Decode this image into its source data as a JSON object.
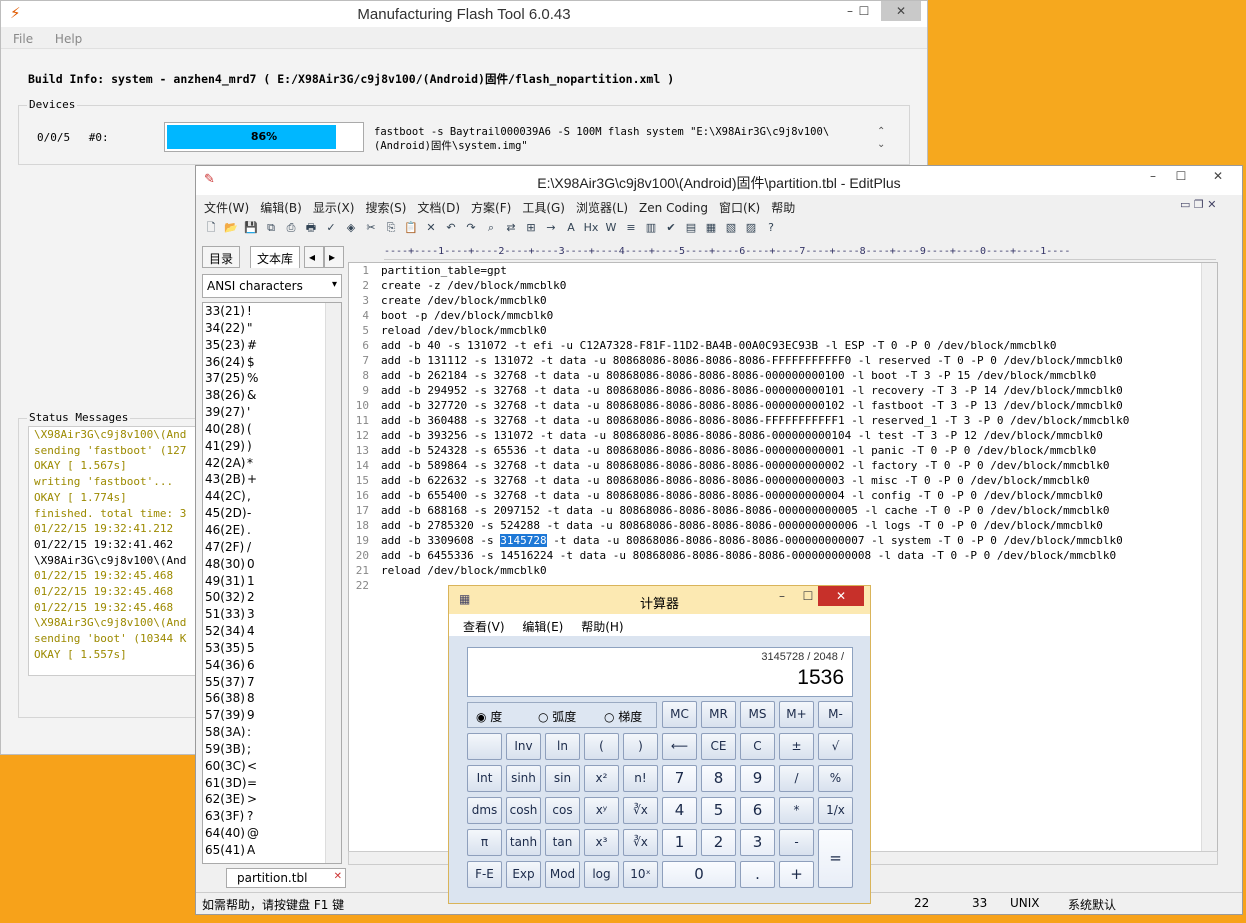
{
  "flash": {
    "title": "Manufacturing Flash Tool 6.0.43",
    "menu": [
      "File",
      "Help"
    ],
    "build_info": "Build Info: system - anzhen4_mrd7 ( E:/X98Air3G/c9j8v100/(Android)固件/flash_nopartition.xml )",
    "devices_title": "Devices",
    "device_port": "0/0/5",
    "device_id": "#0:",
    "progress_text": "86%",
    "progress_value": 86,
    "command": "fastboot -s Baytrail000039A6 -S 100M  flash system \"E:\\X98Air3G\\c9j8v100\\(Android)固件\\system.img\"",
    "status_title": "Status Messages",
    "status_lines": [
      {
        "t": "\\X98Air3G\\c9j8v100\\(And",
        "k": "y"
      },
      {
        "t": "sending 'fastboot' (127",
        "k": "y"
      },
      {
        "t": "OKAY [  1.567s]",
        "k": "y"
      },
      {
        "t": "writing 'fastboot'...",
        "k": "y"
      },
      {
        "t": "OKAY [  1.774s]",
        "k": "y"
      },
      {
        "t": "finished. total time: 3",
        "k": "y"
      },
      {
        "t": "01/22/15 19:32:41.212",
        "k": "y"
      },
      {
        "t": "01/22/15 19:32:41.462",
        "k": "b"
      },
      {
        "t": "\\X98Air3G\\c9j8v100\\(And",
        "k": "b"
      },
      {
        "t": "01/22/15 19:32:45.468",
        "k": "y"
      },
      {
        "t": "01/22/15 19:32:45.468",
        "k": "y"
      },
      {
        "t": "01/22/15 19:32:45.468",
        "k": "y"
      },
      {
        "t": "\\X98Air3G\\c9j8v100\\(And",
        "k": "y"
      },
      {
        "t": "sending 'boot' (10344 K",
        "k": "y"
      },
      {
        "t": "OKAY [  1.557s]",
        "k": "y"
      }
    ]
  },
  "editplus": {
    "title": "E:\\X98Air3G\\c9j8v100\\(Android)固件\\partition.tbl - EditPlus",
    "menu": [
      "文件(W)",
      "编辑(B)",
      "显示(X)",
      "搜索(S)",
      "文档(D)",
      "方案(F)",
      "工具(G)",
      "浏览器(L)",
      "Zen Coding",
      "窗口(K)",
      "帮助"
    ],
    "tab_dir": "目录",
    "tab_lib": "文本库",
    "ansi_label": "ANSI characters",
    "chars": [
      [
        "33(21)",
        "!"
      ],
      [
        "34(22)",
        "\""
      ],
      [
        "35(23)",
        "#"
      ],
      [
        "36(24)",
        "$"
      ],
      [
        "37(25)",
        "%"
      ],
      [
        "38(26)",
        "&"
      ],
      [
        "39(27)",
        "'"
      ],
      [
        "40(28)",
        "("
      ],
      [
        "41(29)",
        ")"
      ],
      [
        "42(2A)",
        "*"
      ],
      [
        "43(2B)",
        "+"
      ],
      [
        "44(2C)",
        ","
      ],
      [
        "45(2D)",
        "-"
      ],
      [
        "46(2E)",
        "."
      ],
      [
        "47(2F)",
        "/"
      ],
      [
        "48(30)",
        "0"
      ],
      [
        "49(31)",
        "1"
      ],
      [
        "50(32)",
        "2"
      ],
      [
        "51(33)",
        "3"
      ],
      [
        "52(34)",
        "4"
      ],
      [
        "53(35)",
        "5"
      ],
      [
        "54(36)",
        "6"
      ],
      [
        "55(37)",
        "7"
      ],
      [
        "56(38)",
        "8"
      ],
      [
        "57(39)",
        "9"
      ],
      [
        "58(3A)",
        ":"
      ],
      [
        "59(3B)",
        ";"
      ],
      [
        "60(3C)",
        "<"
      ],
      [
        "61(3D)",
        "="
      ],
      [
        "62(3E)",
        ">"
      ],
      [
        "63(3F)",
        "?"
      ],
      [
        "64(40)",
        "@"
      ],
      [
        "65(41)",
        "A"
      ]
    ],
    "ruler": "----+----1----+----2----+----3----+----4----+----5----+----6----+----7----+----8----+----9----+----0----+----1----",
    "lines": [
      "partition_table=gpt",
      "create -z /dev/block/mmcblk0",
      "create /dev/block/mmcblk0",
      "boot -p /dev/block/mmcblk0",
      "reload /dev/block/mmcblk0",
      "add -b 40 -s 131072 -t efi -u C12A7328-F81F-11D2-BA4B-00A0C93EC93B -l ESP -T 0 -P 0 /dev/block/mmcblk0",
      "add -b 131112 -s 131072 -t data -u 80868086-8086-8086-8086-FFFFFFFFFFF0 -l reserved -T 0 -P 0 /dev/block/mmcblk0",
      "add -b 262184 -s 32768 -t data -u 80868086-8086-8086-8086-000000000100 -l boot -T 3 -P 15 /dev/block/mmcblk0",
      "add -b 294952 -s 32768 -t data -u 80868086-8086-8086-8086-000000000101 -l recovery -T 3 -P 14 /dev/block/mmcblk0",
      "add -b 327720 -s 32768 -t data -u 80868086-8086-8086-8086-000000000102 -l fastboot -T 3 -P 13 /dev/block/mmcblk0",
      "add -b 360488 -s 32768 -t data -u 80868086-8086-8086-8086-FFFFFFFFFFF1 -l reserved_1 -T 3 -P 0 /dev/block/mmcblk0",
      "add -b 393256 -s 131072 -t data -u 80868086-8086-8086-8086-000000000104 -l test -T 3 -P 12 /dev/block/mmcblk0",
      "add -b 524328 -s 65536 -t data -u 80868086-8086-8086-8086-000000000001 -l panic -T 0 -P 0 /dev/block/mmcblk0",
      "add -b 589864 -s 32768 -t data -u 80868086-8086-8086-8086-000000000002 -l factory -T 0 -P 0 /dev/block/mmcblk0",
      "add -b 622632 -s 32768 -t data -u 80868086-8086-8086-8086-000000000003 -l misc -T 0 -P 0 /dev/block/mmcblk0",
      "add -b 655400 -s 32768 -t data -u 80868086-8086-8086-8086-000000000004 -l config -T 0 -P 0 /dev/block/mmcblk0",
      "add -b 688168 -s 2097152 -t data -u 80868086-8086-8086-8086-000000000005 -l cache -T 0 -P 0 /dev/block/mmcblk0",
      "add -b 2785320 -s 524288 -t data -u 80868086-8086-8086-8086-000000000006 -l logs -T 0 -P 0 /dev/block/mmcblk0",
      "add -b 3309608 -s §3145728§ -t data -u 80868086-8086-8086-8086-000000000007 -l system -T 0 -P 0 /dev/block/mmcblk0",
      "add -b 6455336 -s 14516224 -t data -u 80868086-8086-8086-8086-000000000008 -l data -T 0 -P 0 /dev/block/mmcblk0",
      "reload /dev/block/mmcblk0",
      ""
    ],
    "file_tab": "partition.tbl",
    "status_help": "如需帮助，请按键盘 F1 键",
    "status_line": "22",
    "status_col": "33",
    "status_eol": "UNIX",
    "status_enc": "系统默认"
  },
  "calc": {
    "title": "计算器",
    "menu": [
      "查看(V)",
      "编辑(E)",
      "帮助(H)"
    ],
    "expression": "3145728 / 2048 /",
    "result": "1536",
    "radio_deg": "度",
    "radio_rad": "弧度",
    "radio_grad": "梯度",
    "keys": [
      [
        "",
        "MC",
        "MR",
        "MS",
        "M+",
        "M-"
      ],
      [
        "",
        "Inv",
        "ln",
        "(",
        ")",
        "⟵",
        "CE",
        "C",
        "±",
        "√"
      ],
      [
        "Int",
        "sinh",
        "sin",
        "x²",
        "n!",
        "7",
        "8",
        "9",
        "/",
        "%"
      ],
      [
        "dms",
        "cosh",
        "cos",
        "xʸ",
        "∛x",
        "4",
        "5",
        "6",
        "*",
        "1/x"
      ],
      [
        "π",
        "tanh",
        "tan",
        "x³",
        "∛x",
        "1",
        "2",
        "3",
        "-",
        "="
      ],
      [
        "F-E",
        "Exp",
        "Mod",
        "log",
        "10ˣ",
        "0",
        ".",
        "+"
      ]
    ]
  }
}
